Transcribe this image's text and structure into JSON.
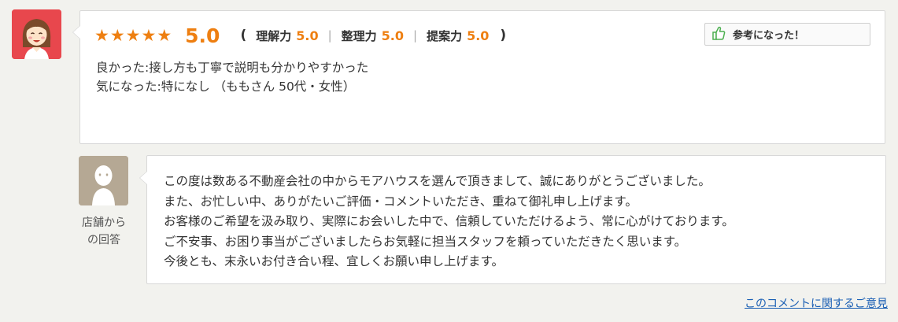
{
  "review": {
    "stars": [
      "★",
      "★",
      "★",
      "★",
      "★"
    ],
    "star_value": 5,
    "score": "5.0",
    "paren_open": "(",
    "paren_close": ")",
    "sub_scores": [
      {
        "label": "理解力",
        "value": "5.0"
      },
      {
        "label": "整理力",
        "value": "5.0"
      },
      {
        "label": "提案力",
        "value": "5.0"
      }
    ],
    "separator": "|",
    "helpful_label": "参考になった！",
    "line1": "良かった:接し方も丁寧で説明も分かりやすかった",
    "line2": "気になった:特になし （ももさん 50代・女性）"
  },
  "reply": {
    "store_caption_line1": "店舗から",
    "store_caption_line2": "の回答",
    "lines": [
      "この度は数ある不動産会社の中からモアハウスを選んで頂きまして、誠にありがとうございました。",
      "また、お忙しい中、ありがたいご評価・コメントいただき、重ねて御礼申し上げます。",
      "お客様のご希望を汲み取り、実際にお会いした中で、信頼していただけるよう、常に心がけております。",
      "ご不安事、お困り事当がございましたらお気軽に担当スタッフを頼っていただきたく思います。",
      "今後とも、末永いお付き合い程、宜しくお願い申し上げます。"
    ]
  },
  "footer": {
    "feedback_link": "このコメントに関するご意見"
  },
  "colors": {
    "accent_orange": "#ee7f11",
    "avatar_red": "#e8474d",
    "store_avatar": "#b5a894",
    "link_blue": "#1a5fb4"
  },
  "icons": [
    "user-avatar-icon",
    "star-icon",
    "thumbs-up-hand-icon",
    "store-staff-avatar-icon"
  ]
}
